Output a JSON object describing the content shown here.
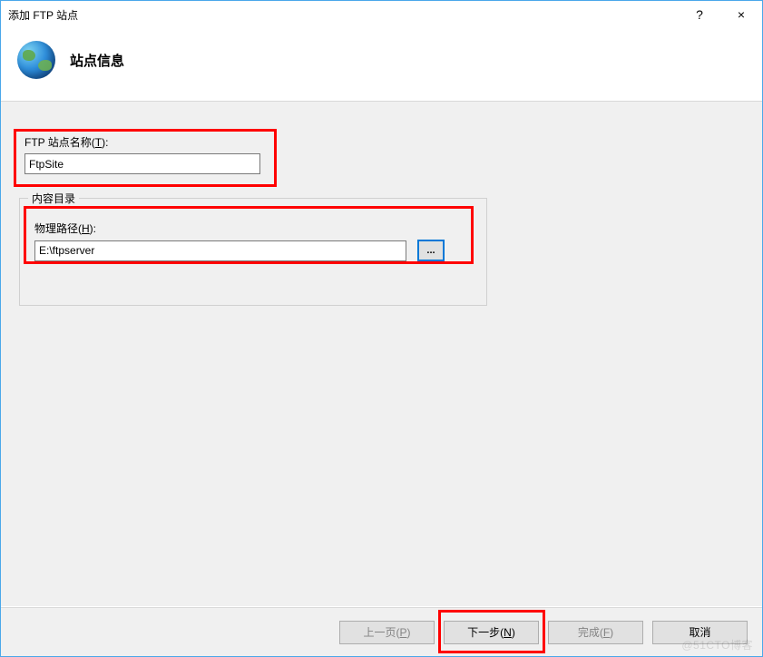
{
  "window": {
    "title": "添加 FTP 站点",
    "help": "?",
    "close": "×"
  },
  "header": {
    "title": "站点信息"
  },
  "form": {
    "site_name_label_pre": "FTP 站点名称(",
    "site_name_key": "T",
    "site_name_label_post": "):",
    "site_name_value": "FtpSite",
    "content_dir_legend": "内容目录",
    "phys_path_label_pre": "物理路径(",
    "phys_path_key": "H",
    "phys_path_label_post": "):",
    "phys_path_value": "E:\\ftpserver",
    "browse_label": "..."
  },
  "footer": {
    "prev": "上一页(P)",
    "next": "下一步(N)",
    "finish": "完成(F)",
    "cancel": "取消"
  },
  "watermark": "@51CTO博客"
}
